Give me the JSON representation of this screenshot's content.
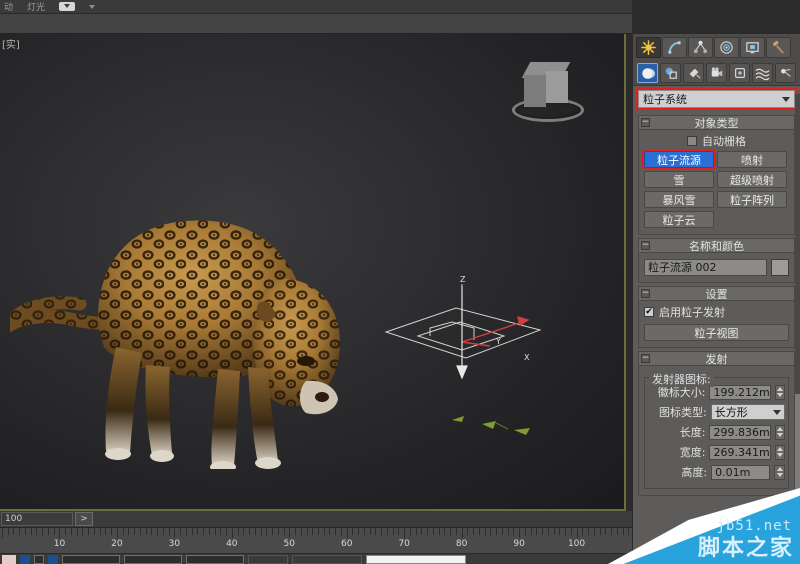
{
  "app": {
    "viewport_label": "[实]",
    "menu_items": [
      "动",
      "灯光"
    ],
    "menu_icon": "light-dropdown-icon"
  },
  "viewport": {
    "objects": {
      "model_name": "leopard-model",
      "gizmo_name": "particle-flow-emitter-gizmo",
      "axis_labels": [
        "Z",
        "Y",
        "X"
      ],
      "viewcube_name": "viewcube"
    }
  },
  "command_panel": {
    "tabs": [
      {
        "name": "create-tab",
        "icon": "star-icon",
        "active": true
      },
      {
        "name": "modify-tab",
        "icon": "bend-arc-icon",
        "active": false
      },
      {
        "name": "hierarchy-tab",
        "icon": "hierarchy-icon",
        "active": false
      },
      {
        "name": "motion-tab",
        "icon": "motion-wheel-icon",
        "active": false
      },
      {
        "name": "display-tab",
        "icon": "monitor-icon",
        "active": false
      },
      {
        "name": "utilities-tab",
        "icon": "hammer-icon",
        "active": false
      }
    ],
    "categories": [
      {
        "name": "geometry-category",
        "icon": "sphere-icon",
        "active": true
      },
      {
        "name": "shapes-category",
        "icon": "shapes-icon",
        "active": false
      },
      {
        "name": "lights-category",
        "icon": "light-icon",
        "active": false
      },
      {
        "name": "cameras-category",
        "icon": "camera-icon",
        "active": false
      },
      {
        "name": "helpers-category",
        "icon": "helper-icon",
        "active": false
      },
      {
        "name": "space-warps-category",
        "icon": "wave-icon",
        "active": false
      },
      {
        "name": "systems-category",
        "icon": "systems-icon",
        "active": false
      }
    ],
    "category_dropdown": {
      "value": "粒子系统",
      "highlighted": true
    },
    "object_type": {
      "title": "对象类型",
      "autogrid_label": "自动栅格",
      "autogrid_checked": false,
      "buttons": [
        {
          "label": "粒子流源",
          "selected": true,
          "highlighted": true
        },
        {
          "label": "喷射",
          "selected": false,
          "highlighted": false
        },
        {
          "label": "雪",
          "selected": false,
          "highlighted": false
        },
        {
          "label": "超级喷射",
          "selected": false,
          "highlighted": false
        },
        {
          "label": "暴风雪",
          "selected": false,
          "highlighted": false
        },
        {
          "label": "粒子阵列",
          "selected": false,
          "highlighted": false
        },
        {
          "label": "粒子云",
          "selected": false,
          "highlighted": false
        }
      ]
    },
    "name_and_color": {
      "title": "名称和颜色",
      "object_name": "粒子流源 002",
      "color": "#9d9b98"
    },
    "settings": {
      "title": "设置",
      "enable_emission_label": "启用粒子发射",
      "enable_emission_checked": true,
      "particle_view_label": "粒子视图"
    },
    "emission": {
      "title": "发射",
      "group_title": "发射器图标:",
      "fields": [
        {
          "label": "徽标大小:",
          "value": "199.212m",
          "name": "logo-size-field"
        },
        {
          "label": "长度:",
          "value": "299.836m",
          "name": "length-field"
        },
        {
          "label": "宽度:",
          "value": "269.341m",
          "name": "width-field"
        },
        {
          "label": "高度:",
          "value": "0.01m",
          "name": "height-field"
        }
      ],
      "icon_type": {
        "label": "图标类型:",
        "value": "长方形"
      }
    }
  },
  "timeline": {
    "frame_value": "100",
    "next_button": ">",
    "tick_labels": [
      "10",
      "20",
      "30",
      "40",
      "50",
      "60",
      "70",
      "80",
      "90",
      "100"
    ]
  },
  "watermark": {
    "url": "jb51.net",
    "site_name": "脚本之家",
    "accent_color": "#29a3dd"
  }
}
